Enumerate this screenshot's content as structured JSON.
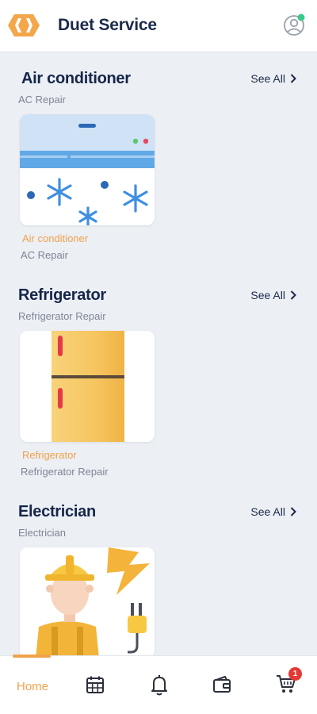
{
  "header": {
    "title": "Duet Service",
    "logo_icon": "orange-hexagon-logo",
    "profile_icon": "user-profile-icon",
    "status_color": "#3ec88a"
  },
  "sections": [
    {
      "title": "Air conditioner",
      "subtitle": "AC Repair",
      "see_all": "See All",
      "card": {
        "title": "Air conditioner",
        "subtitle": "AC Repair",
        "image": "air-conditioner-image"
      }
    },
    {
      "title": "Refrigerator",
      "subtitle": "Refrigerator Repair",
      "see_all": "See All",
      "card": {
        "title": "Refrigerator",
        "subtitle": "Refrigerator Repair",
        "image": "refrigerator-image"
      }
    },
    {
      "title": "Electrician",
      "subtitle": "Electrician",
      "see_all": "See All",
      "card": {
        "image": "electrician-image"
      }
    }
  ],
  "bottom_nav": {
    "home_label": "Home",
    "items": [
      "home",
      "calendar-icon",
      "bell-icon",
      "wallet-icon",
      "cart-icon"
    ],
    "cart_badge": "1",
    "active_color": "#f0a24a"
  },
  "colors": {
    "accent": "#f0a24a",
    "title": "#16264a",
    "background": "#eceff4",
    "badge": "#e53935"
  }
}
